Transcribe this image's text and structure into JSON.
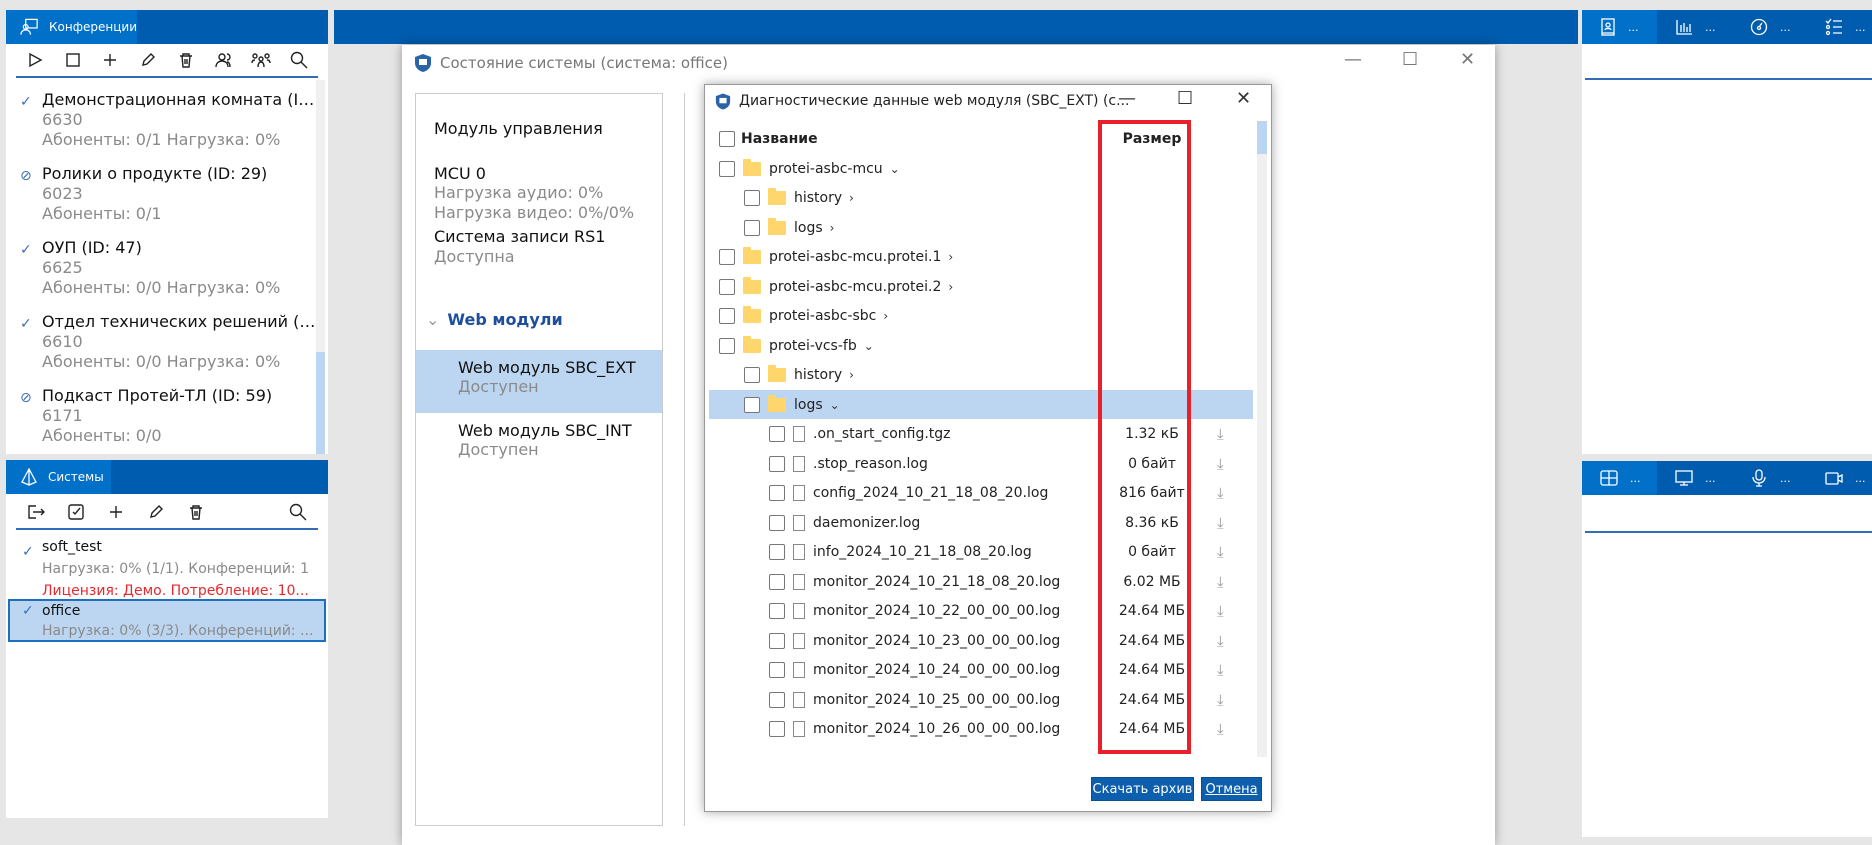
{
  "conferences": {
    "tab_label": "Конференции",
    "toolbar": [
      "play-icon",
      "stop-icon",
      "plus-icon",
      "pencil-icon",
      "trash-icon",
      "users-icon",
      "group-icon",
      "search-icon"
    ],
    "items": [
      {
        "title": "Демонстрационная комната (ID:...",
        "number": "6630",
        "info": "Абоненты: 0/1 Нагрузка: 0%",
        "status": "active"
      },
      {
        "title": "Ролики о продукте (ID: 29)",
        "number": "6023",
        "info": "Абоненты: 0/1",
        "status": "disabled"
      },
      {
        "title": "ОУП (ID: 47)",
        "number": "6625",
        "info": "Абоненты: 0/0 Нагрузка: 0%",
        "status": "active"
      },
      {
        "title": "Отдел технических решений (ID: ...",
        "number": "6610",
        "info": "Абоненты: 0/0 Нагрузка: 0%",
        "status": "active"
      },
      {
        "title": "Подкаст Протей-ТЛ (ID: 59)",
        "number": "6171",
        "info": "Абоненты: 0/0",
        "status": "disabled"
      }
    ]
  },
  "systems": {
    "tab_label": "Системы",
    "items": [
      {
        "name": "soft_test",
        "load": "Нагрузка: 0% (1/1). Конференций: 1",
        "license": "Лицензия: Демо. Потребление: 10..."
      },
      {
        "name": "office",
        "load": "Нагрузка: 0% (3/3). Конференций: ...",
        "selected": true
      }
    ]
  },
  "status_window": {
    "title": "Состояние системы (система: office)",
    "control_module": "Модуль управления",
    "mcu": {
      "name": "MCU 0",
      "audio": "Нагрузка аудио: 0%",
      "video": "Нагрузка видео: 0%/0%"
    },
    "recorder": {
      "name": "Система записи RS1",
      "status": "Доступна"
    },
    "web_group": "Web модули",
    "web_modules": [
      {
        "name": "Web модуль SBC_EXT",
        "status": "Доступен",
        "selected": true
      },
      {
        "name": "Web модуль SBC_INT",
        "status": "Доступен"
      }
    ]
  },
  "dialog": {
    "title": "Диагностические данные web модуля (SBC_EXT) (с...",
    "col_name": "Название",
    "col_size": "Размер",
    "rows": [
      {
        "name": "protei-asbc-mcu",
        "type": "folder",
        "level": 0,
        "chev": "⌄"
      },
      {
        "name": "history",
        "type": "folder",
        "level": 1,
        "chev": "›"
      },
      {
        "name": "logs",
        "type": "folder",
        "level": 1,
        "chev": "›"
      },
      {
        "name": "protei-asbc-mcu.protei.1",
        "type": "folder",
        "level": 0,
        "chev": "›"
      },
      {
        "name": "protei-asbc-mcu.protei.2",
        "type": "folder",
        "level": 0,
        "chev": "›"
      },
      {
        "name": "protei-asbc-sbc",
        "type": "folder",
        "level": 0,
        "chev": "›"
      },
      {
        "name": "protei-vcs-fb",
        "type": "folder",
        "level": 0,
        "chev": "⌄"
      },
      {
        "name": "history",
        "type": "folder",
        "level": 1,
        "chev": "›"
      },
      {
        "name": "logs",
        "type": "folder",
        "level": 1,
        "chev": "⌄",
        "selected": true
      },
      {
        "name": ".on_start_config.tgz",
        "type": "file",
        "level": 2,
        "size": "1.32 кБ"
      },
      {
        "name": ".stop_reason.log",
        "type": "file",
        "level": 2,
        "size": "0 байт"
      },
      {
        "name": "config_2024_10_21_18_08_20.log",
        "type": "file",
        "level": 2,
        "size": "816 байт"
      },
      {
        "name": "daemonizer.log",
        "type": "file",
        "level": 2,
        "size": "8.36 кБ"
      },
      {
        "name": "info_2024_10_21_18_08_20.log",
        "type": "file",
        "level": 2,
        "size": "0 байт"
      },
      {
        "name": "monitor_2024_10_21_18_08_20.log",
        "type": "file",
        "level": 2,
        "size": "6.02 МБ"
      },
      {
        "name": "monitor_2024_10_22_00_00_00.log",
        "type": "file",
        "level": 2,
        "size": "24.64 МБ"
      },
      {
        "name": "monitor_2024_10_23_00_00_00.log",
        "type": "file",
        "level": 2,
        "size": "24.64 МБ"
      },
      {
        "name": "monitor_2024_10_24_00_00_00.log",
        "type": "file",
        "level": 2,
        "size": "24.64 МБ"
      },
      {
        "name": "monitor_2024_10_25_00_00_00.log",
        "type": "file",
        "level": 2,
        "size": "24.64 МБ"
      },
      {
        "name": "monitor_2024_10_26_00_00_00.log",
        "type": "file",
        "level": 2,
        "size": "24.64 МБ"
      }
    ],
    "download_button": "Скачать архив",
    "cancel_button": "Отмена",
    "highlight_color": "#e8202a"
  },
  "right_top_tabs": [
    {
      "icon": "contact-book-icon",
      "label": "..."
    },
    {
      "icon": "bar-chart-icon",
      "label": "..."
    },
    {
      "icon": "gauge-icon",
      "label": "..."
    },
    {
      "icon": "checklist-icon",
      "label": "..."
    }
  ],
  "right_bottom_tabs": [
    {
      "icon": "layout-grid-icon",
      "label": "..."
    },
    {
      "icon": "monitor-icon",
      "label": "..."
    },
    {
      "icon": "microphone-icon",
      "label": "..."
    },
    {
      "icon": "video-camera-icon",
      "label": "..."
    }
  ],
  "colors": {
    "header": "#005cae",
    "active_tab": "#0070c8",
    "selection": "#bcd6f1"
  }
}
